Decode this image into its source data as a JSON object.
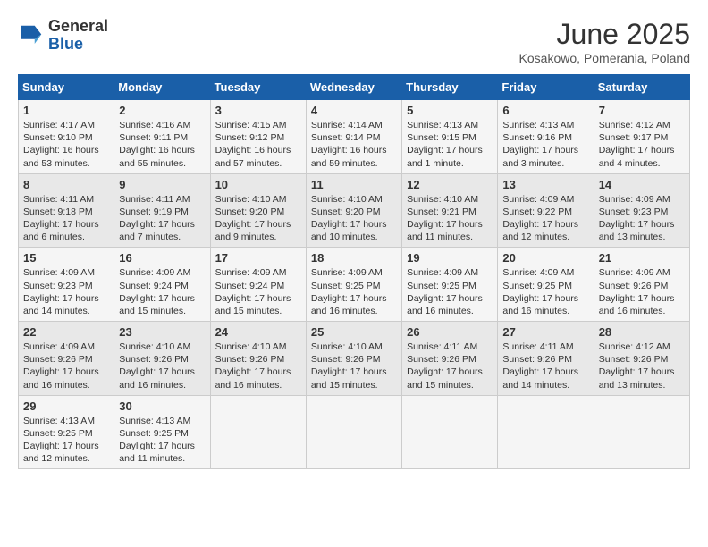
{
  "header": {
    "logo_general": "General",
    "logo_blue": "Blue",
    "title": "June 2025",
    "location": "Kosakowo, Pomerania, Poland"
  },
  "weekdays": [
    "Sunday",
    "Monday",
    "Tuesday",
    "Wednesday",
    "Thursday",
    "Friday",
    "Saturday"
  ],
  "weeks": [
    [
      {
        "day": "1",
        "info": "Sunrise: 4:17 AM\nSunset: 9:10 PM\nDaylight: 16 hours\nand 53 minutes."
      },
      {
        "day": "2",
        "info": "Sunrise: 4:16 AM\nSunset: 9:11 PM\nDaylight: 16 hours\nand 55 minutes."
      },
      {
        "day": "3",
        "info": "Sunrise: 4:15 AM\nSunset: 9:12 PM\nDaylight: 16 hours\nand 57 minutes."
      },
      {
        "day": "4",
        "info": "Sunrise: 4:14 AM\nSunset: 9:14 PM\nDaylight: 16 hours\nand 59 minutes."
      },
      {
        "day": "5",
        "info": "Sunrise: 4:13 AM\nSunset: 9:15 PM\nDaylight: 17 hours\nand 1 minute."
      },
      {
        "day": "6",
        "info": "Sunrise: 4:13 AM\nSunset: 9:16 PM\nDaylight: 17 hours\nand 3 minutes."
      },
      {
        "day": "7",
        "info": "Sunrise: 4:12 AM\nSunset: 9:17 PM\nDaylight: 17 hours\nand 4 minutes."
      }
    ],
    [
      {
        "day": "8",
        "info": "Sunrise: 4:11 AM\nSunset: 9:18 PM\nDaylight: 17 hours\nand 6 minutes."
      },
      {
        "day": "9",
        "info": "Sunrise: 4:11 AM\nSunset: 9:19 PM\nDaylight: 17 hours\nand 7 minutes."
      },
      {
        "day": "10",
        "info": "Sunrise: 4:10 AM\nSunset: 9:20 PM\nDaylight: 17 hours\nand 9 minutes."
      },
      {
        "day": "11",
        "info": "Sunrise: 4:10 AM\nSunset: 9:20 PM\nDaylight: 17 hours\nand 10 minutes."
      },
      {
        "day": "12",
        "info": "Sunrise: 4:10 AM\nSunset: 9:21 PM\nDaylight: 17 hours\nand 11 minutes."
      },
      {
        "day": "13",
        "info": "Sunrise: 4:09 AM\nSunset: 9:22 PM\nDaylight: 17 hours\nand 12 minutes."
      },
      {
        "day": "14",
        "info": "Sunrise: 4:09 AM\nSunset: 9:23 PM\nDaylight: 17 hours\nand 13 minutes."
      }
    ],
    [
      {
        "day": "15",
        "info": "Sunrise: 4:09 AM\nSunset: 9:23 PM\nDaylight: 17 hours\nand 14 minutes."
      },
      {
        "day": "16",
        "info": "Sunrise: 4:09 AM\nSunset: 9:24 PM\nDaylight: 17 hours\nand 15 minutes."
      },
      {
        "day": "17",
        "info": "Sunrise: 4:09 AM\nSunset: 9:24 PM\nDaylight: 17 hours\nand 15 minutes."
      },
      {
        "day": "18",
        "info": "Sunrise: 4:09 AM\nSunset: 9:25 PM\nDaylight: 17 hours\nand 16 minutes."
      },
      {
        "day": "19",
        "info": "Sunrise: 4:09 AM\nSunset: 9:25 PM\nDaylight: 17 hours\nand 16 minutes."
      },
      {
        "day": "20",
        "info": "Sunrise: 4:09 AM\nSunset: 9:25 PM\nDaylight: 17 hours\nand 16 minutes."
      },
      {
        "day": "21",
        "info": "Sunrise: 4:09 AM\nSunset: 9:26 PM\nDaylight: 17 hours\nand 16 minutes."
      }
    ],
    [
      {
        "day": "22",
        "info": "Sunrise: 4:09 AM\nSunset: 9:26 PM\nDaylight: 17 hours\nand 16 minutes."
      },
      {
        "day": "23",
        "info": "Sunrise: 4:10 AM\nSunset: 9:26 PM\nDaylight: 17 hours\nand 16 minutes."
      },
      {
        "day": "24",
        "info": "Sunrise: 4:10 AM\nSunset: 9:26 PM\nDaylight: 17 hours\nand 16 minutes."
      },
      {
        "day": "25",
        "info": "Sunrise: 4:10 AM\nSunset: 9:26 PM\nDaylight: 17 hours\nand 15 minutes."
      },
      {
        "day": "26",
        "info": "Sunrise: 4:11 AM\nSunset: 9:26 PM\nDaylight: 17 hours\nand 15 minutes."
      },
      {
        "day": "27",
        "info": "Sunrise: 4:11 AM\nSunset: 9:26 PM\nDaylight: 17 hours\nand 14 minutes."
      },
      {
        "day": "28",
        "info": "Sunrise: 4:12 AM\nSunset: 9:26 PM\nDaylight: 17 hours\nand 13 minutes."
      }
    ],
    [
      {
        "day": "29",
        "info": "Sunrise: 4:13 AM\nSunset: 9:25 PM\nDaylight: 17 hours\nand 12 minutes."
      },
      {
        "day": "30",
        "info": "Sunrise: 4:13 AM\nSunset: 9:25 PM\nDaylight: 17 hours\nand 11 minutes."
      },
      {
        "day": "",
        "info": ""
      },
      {
        "day": "",
        "info": ""
      },
      {
        "day": "",
        "info": ""
      },
      {
        "day": "",
        "info": ""
      },
      {
        "day": "",
        "info": ""
      }
    ]
  ]
}
